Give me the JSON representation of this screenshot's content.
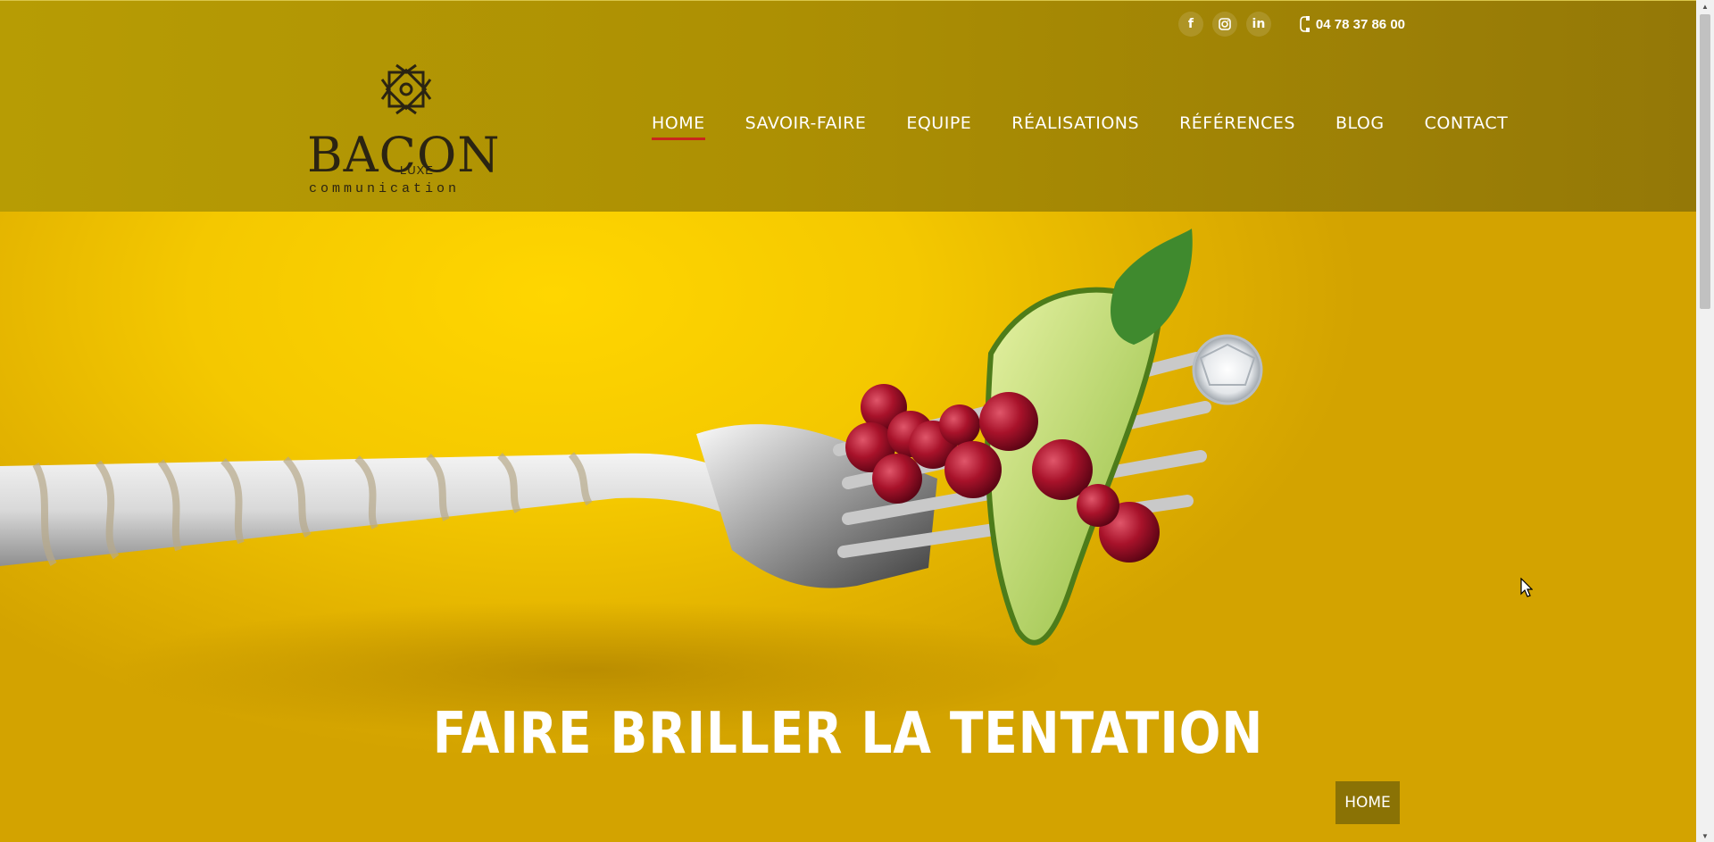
{
  "colors": {
    "header": "#ad9003",
    "hero": "#f4c800",
    "accent_underline": "#c8281c",
    "breadcrumb_bg": "#8a7205"
  },
  "header": {
    "social": [
      {
        "icon": "facebook-icon",
        "label": "f"
      },
      {
        "icon": "instagram-icon",
        "label": ""
      },
      {
        "icon": "linkedin-icon",
        "label": "in"
      }
    ],
    "phone_icon": "phone-icon",
    "phone": "04 78 37 86 00",
    "logo": {
      "word": "BACON",
      "luxe": "LUXE",
      "sub": "communication"
    },
    "nav": [
      {
        "label": "HOME",
        "active": true
      },
      {
        "label": "SAVOIR-FAIRE"
      },
      {
        "label": "EQUIPE"
      },
      {
        "label": "RÉALISATIONS"
      },
      {
        "label": "RÉFÉRENCES"
      },
      {
        "label": "BLOG"
      },
      {
        "label": "CONTACT"
      }
    ]
  },
  "hero": {
    "headline": "FAIRE BRILLER LA TENTATION",
    "breadcrumb": "HOME"
  }
}
